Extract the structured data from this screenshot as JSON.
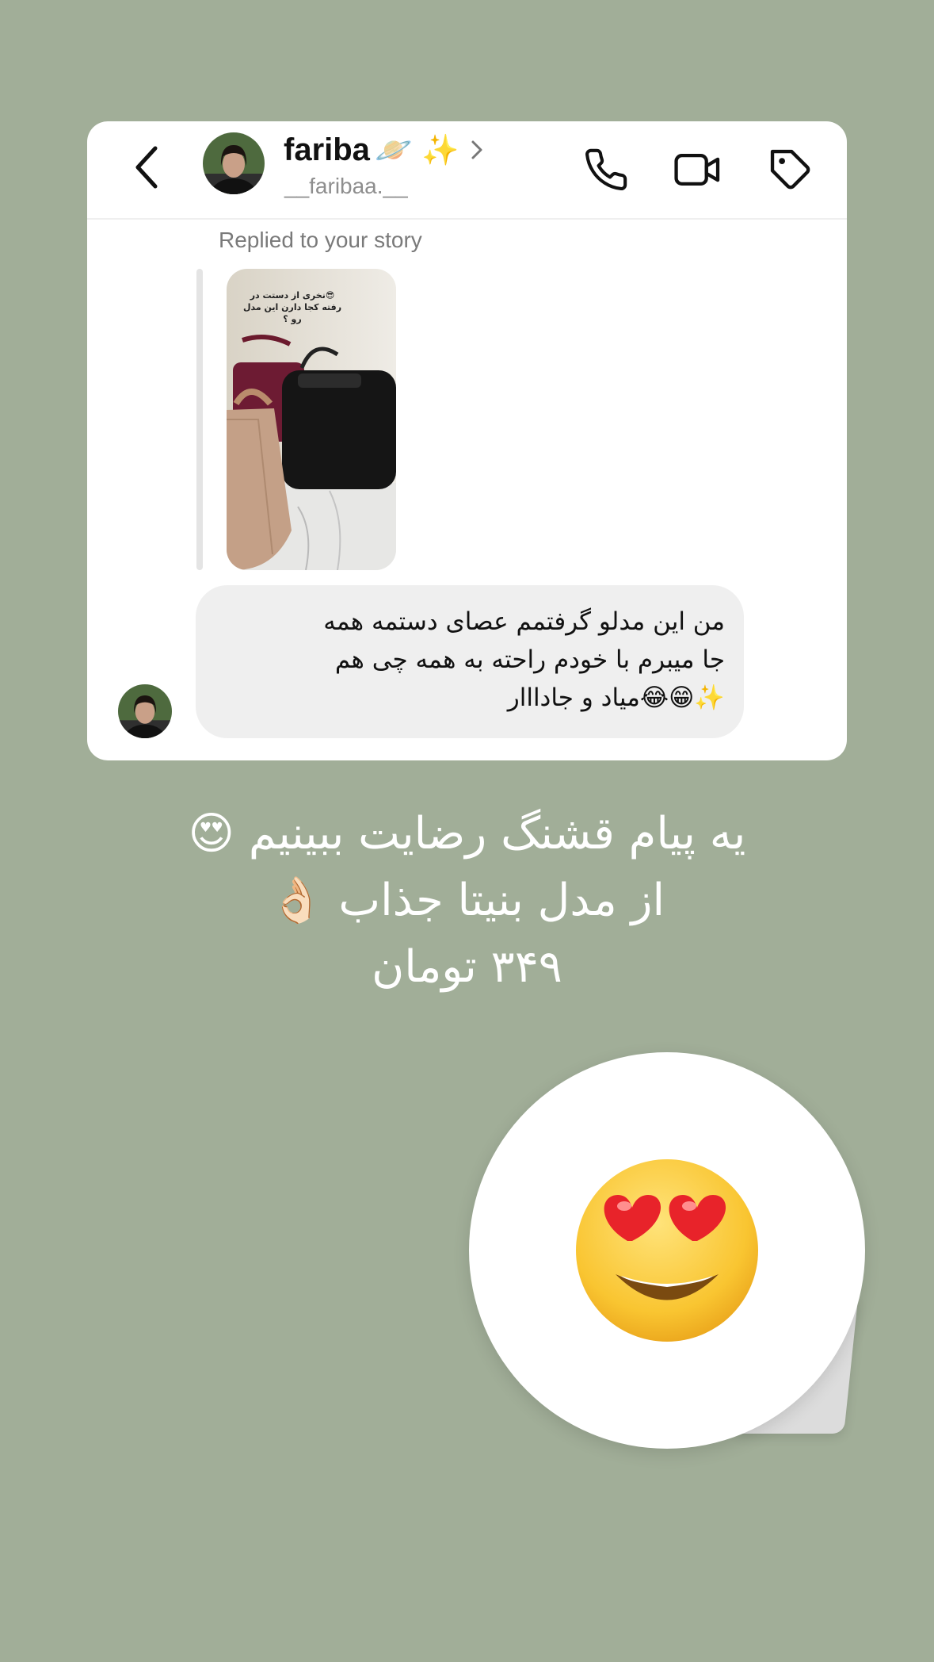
{
  "header": {
    "name": "fariba",
    "name_emoji": "🪐 ✨",
    "handle": "__faribaa.__",
    "icons": [
      "back-icon",
      "phone-icon",
      "video-icon",
      "tag-icon",
      "chevron-right-icon"
    ]
  },
  "thread": {
    "replied_label": "Replied to your story",
    "story": {
      "caption": "😎نخری از دستت در رفته کجا دارن این مدل رو ؟"
    },
    "message": "من این مدلو گرفتمم عصای دستمه همه\nجا میبرم با خودم راحته به همه چی هم\n✨😁😂میاد و جادااار"
  },
  "overlay": {
    "line1": "یه پیام قشنگ رضایت ببینیم 😍",
    "line2": "از مدل بنیتا جذاب 👌🏻",
    "line3": "۳۴۹ تومان"
  },
  "sticker": {
    "emoji": "😍"
  },
  "colors": {
    "background": "#a1ae98",
    "card": "#ffffff",
    "bubble": "#efefef",
    "handle": "#8e8e8e"
  }
}
